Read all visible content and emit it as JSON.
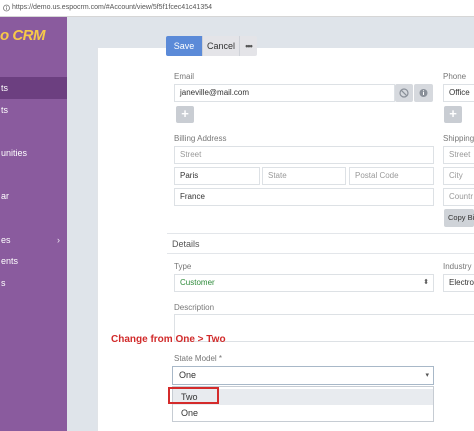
{
  "browser": {
    "url": "https://demo.us.espocrm.com/#Account/view/5f5f1fcec41c41354"
  },
  "sidebar": {
    "logo": "o CRM",
    "items": [
      {
        "label": "ts"
      },
      {
        "label": "ts"
      },
      {
        "label": "unities"
      },
      {
        "label": "ar"
      },
      {
        "label": "es"
      },
      {
        "label": "ents"
      },
      {
        "label": "s"
      }
    ]
  },
  "toolbar": {
    "save_label": "Save",
    "cancel_label": "Cancel",
    "more_label": "•••"
  },
  "form": {
    "email_label": "Email",
    "email_value": "janeville@mail.com",
    "phone_label": "Phone",
    "phone_type": "Office",
    "billing_label": "Billing Address",
    "billing_street_placeholder": "Street",
    "billing_city_value": "Paris",
    "billing_state_placeholder": "State",
    "billing_postal_placeholder": "Postal Code",
    "billing_country_value": "France",
    "shipping_label": "Shipping",
    "shipping_street_placeholder": "Street",
    "shipping_city_placeholder": "City",
    "shipping_country_placeholder": "Countr",
    "copy_billing_label": "Copy Bi",
    "details_heading": "Details",
    "type_label": "Type",
    "type_value": "Customer",
    "industry_label": "Industry",
    "industry_value": "Electro",
    "description_label": "Description",
    "state_model_label": "State Model *",
    "state_model_value": "One"
  },
  "annotation": "Change from One > Two",
  "dropdown": {
    "options": [
      "Two",
      "One"
    ]
  },
  "colors": {
    "sidebar": "#8a5b9e",
    "sidebar_active": "#6c3f80",
    "primary_button": "#5b8ad8",
    "annotation_red": "#d12a2a",
    "type_value_green": "#2e8b3a"
  }
}
